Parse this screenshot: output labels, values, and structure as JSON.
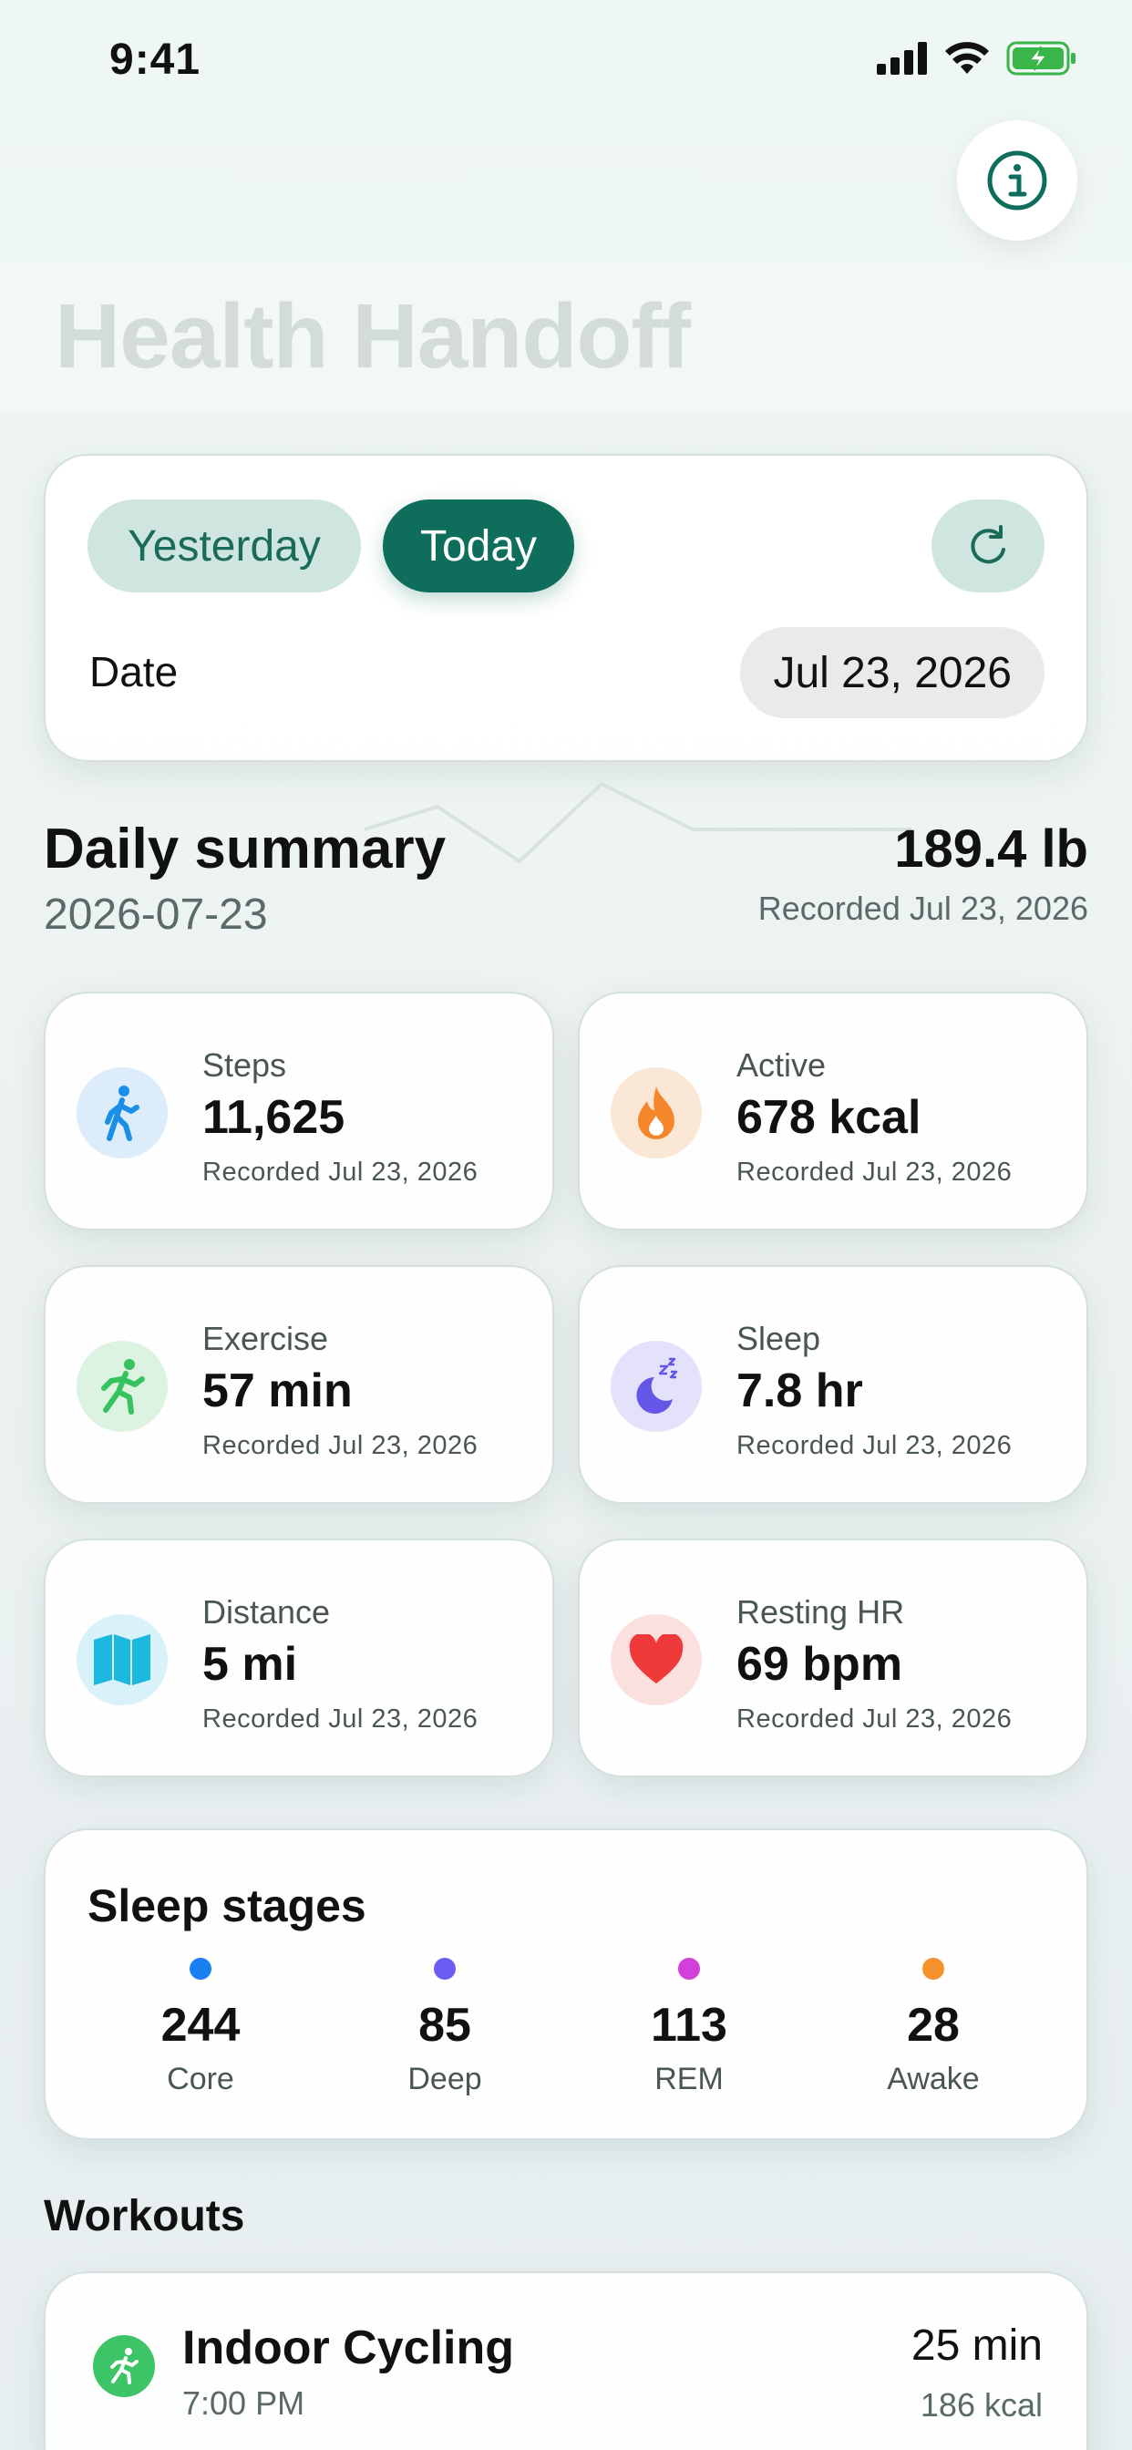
{
  "status_bar": {
    "time": "9:41"
  },
  "header": {
    "title": "Health Handoff"
  },
  "date_selector": {
    "yesterday_label": "Yesterday",
    "today_label": "Today",
    "date_label": "Date",
    "date_value": "Jul 23, 2026"
  },
  "summary": {
    "title": "Daily summary",
    "date": "2026-07-23",
    "weight": "189.4 lb",
    "weight_note": "Recorded Jul 23, 2026"
  },
  "metrics": [
    {
      "label": "Steps",
      "value": "11,625",
      "note": "Recorded Jul 23, 2026",
      "icon": "walking-icon",
      "color": "#1a8fe8"
    },
    {
      "label": "Active",
      "value": "678 kcal",
      "note": "Recorded Jul 23, 2026",
      "icon": "flame-icon",
      "color": "#f5862a"
    },
    {
      "label": "Exercise",
      "value": "57 min",
      "note": "Recorded Jul 23, 2026",
      "icon": "running-icon",
      "color": "#35c25f"
    },
    {
      "label": "Sleep",
      "value": "7.8 hr",
      "note": "Recorded Jul 23, 2026",
      "icon": "moon-icon",
      "color": "#6457e8"
    },
    {
      "label": "Distance",
      "value": "5 mi",
      "note": "Recorded Jul 23, 2026",
      "icon": "map-icon",
      "color": "#1cb8e0"
    },
    {
      "label": "Resting HR",
      "value": "69 bpm",
      "note": "Recorded Jul 23, 2026",
      "icon": "heart-icon",
      "color": "#f03a3a"
    }
  ],
  "sleep_stages": {
    "title": "Sleep stages",
    "stages": [
      {
        "value": "244",
        "label": "Core",
        "color": "#1a7ff0"
      },
      {
        "value": "85",
        "label": "Deep",
        "color": "#6a5cf0"
      },
      {
        "value": "113",
        "label": "REM",
        "color": "#d23fd9"
      },
      {
        "value": "28",
        "label": "Awake",
        "color": "#f5902a"
      }
    ]
  },
  "workouts": {
    "title": "Workouts",
    "items": [
      {
        "name": "Indoor Cycling",
        "time": "7:00 PM",
        "duration": "25 min",
        "kcal": "186 kcal"
      }
    ]
  },
  "colors": {
    "accent": "#0e6e5b",
    "accent_light": "#cfe6e0"
  }
}
